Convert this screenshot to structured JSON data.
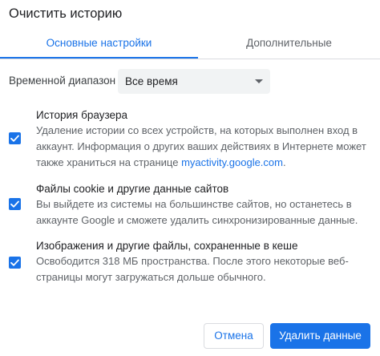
{
  "dialog": {
    "title": "Очистить историю"
  },
  "tabs": [
    {
      "label": "Основные настройки",
      "selected": true
    },
    {
      "label": "Дополнительные",
      "selected": false
    }
  ],
  "time_range": {
    "label": "Временной диапазон",
    "selected": "Все время"
  },
  "options": [
    {
      "title": "История браузера",
      "checked": true,
      "desc_before": "Удаление истории со всех устройств, на которых выполнен вход в аккаунт. Информация о других ваших действиях в Интернете может также храниться на странице ",
      "desc_link": "myactivity.google.com",
      "desc_after": "."
    },
    {
      "title": "Файлы cookie и другие данные сайтов",
      "checked": true,
      "desc": "Вы выйдете из системы на большинстве сайтов, но останетесь в аккаунте Google и сможете удалить синхронизированные данные."
    },
    {
      "title": "Изображения и другие файлы, сохраненные в кеше",
      "checked": true,
      "desc": "Освободится 318 МБ пространства. После этого некоторые веб-страницы могут загружаться дольше обычного."
    }
  ],
  "buttons": {
    "cancel": "Отмена",
    "confirm": "Удалить данные"
  },
  "colors": {
    "accent": "#1a73e8",
    "text_primary": "#202124",
    "text_secondary": "#5f6368",
    "divider": "#dadce0"
  },
  "icons": {
    "select_arrow": "caret-down-icon",
    "checkbox_mark": "checkmark-icon"
  }
}
